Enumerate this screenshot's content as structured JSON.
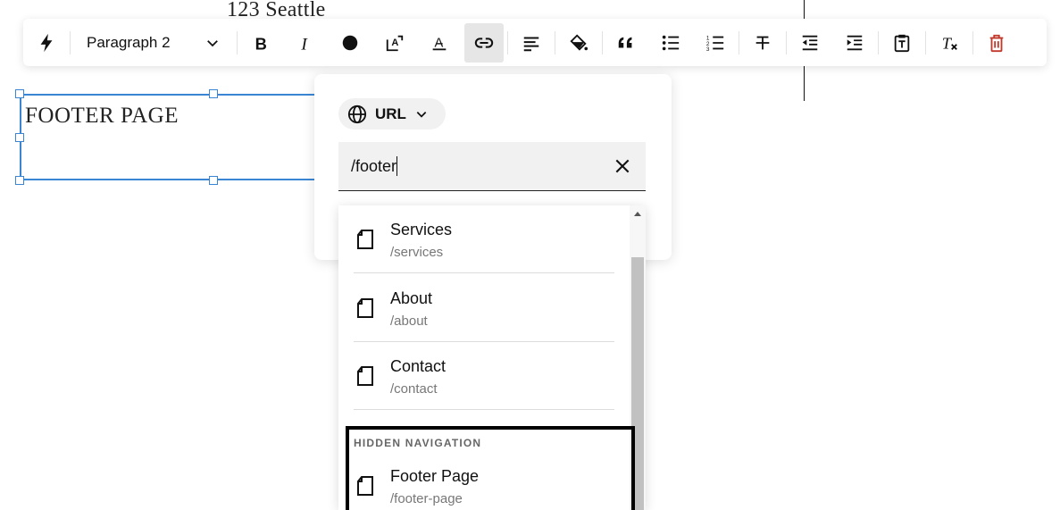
{
  "canvas": {
    "address_text": "123 Seattle",
    "footer_block_text": "FOOTER PAGE"
  },
  "toolbar": {
    "paragraph_style": "Paragraph 2",
    "buttons": [
      "quick-actions",
      "bold",
      "italic",
      "text-color",
      "font-size",
      "text-highlight",
      "link",
      "align-left",
      "fill",
      "blockquote",
      "bulleted-list",
      "numbered-list",
      "strikethrough",
      "outdent",
      "indent",
      "paste-plain-text",
      "clear-formatting",
      "delete"
    ],
    "active_button": "link",
    "delete_color": "#c0392b"
  },
  "link_popover": {
    "link_type": "URL",
    "input_value": "/footer"
  },
  "results": {
    "items": [
      {
        "title": "Services",
        "path": "/services"
      },
      {
        "title": "About",
        "path": "/about"
      },
      {
        "title": "Contact",
        "path": "/contact"
      }
    ],
    "hidden_section_label": "HIDDEN NAVIGATION",
    "hidden_items": [
      {
        "title": "Footer Page",
        "path": "/footer-page"
      }
    ]
  },
  "colors": {
    "selection_blue": "#3b86d4",
    "active_bg": "#e6e6e6"
  }
}
